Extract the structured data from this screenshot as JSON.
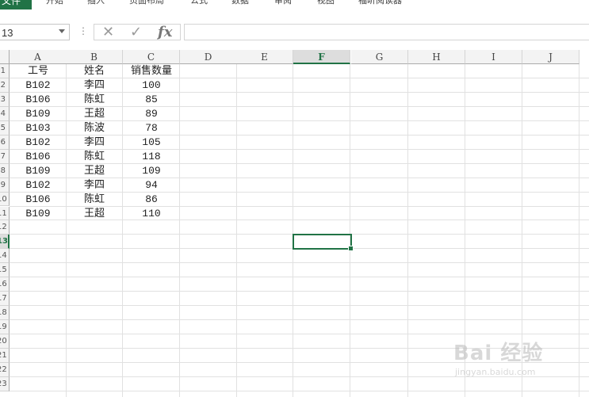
{
  "ribbon": {
    "file_tab": "文件",
    "tabs": [
      "开始",
      "插入",
      "页面布局",
      "公式",
      "数据",
      "审阅",
      "视图",
      "福昕阅读器"
    ]
  },
  "formula_bar": {
    "name_box_value": "13",
    "more_label": "⋮",
    "cancel_icon": "✕",
    "enter_icon": "✓",
    "fx_label": "fx",
    "formula_value": ""
  },
  "sheet": {
    "columns": [
      "A",
      "B",
      "C",
      "D",
      "E",
      "F",
      "G",
      "H",
      "I",
      "J"
    ],
    "selected_column": "F",
    "row_numbers": [
      "1",
      "2",
      "3",
      "4",
      "5",
      "6",
      "7",
      "8",
      "9",
      "10",
      "11",
      "12",
      "13",
      "14",
      "15",
      "16",
      "17",
      "18",
      "19",
      "20",
      "21",
      "22",
      "23"
    ],
    "selected_row": "13",
    "headers": [
      "工号",
      "姓名",
      "销售数量"
    ],
    "rows": [
      [
        "B102",
        "李四",
        "100"
      ],
      [
        "B106",
        "陈虹",
        "85"
      ],
      [
        "B109",
        "王超",
        "89"
      ],
      [
        "B103",
        "陈波",
        "78"
      ],
      [
        "B102",
        "李四",
        "105"
      ],
      [
        "B106",
        "陈虹",
        "118"
      ],
      [
        "B109",
        "王超",
        "109"
      ],
      [
        "B102",
        "李四",
        "94"
      ],
      [
        "B106",
        "陈虹",
        "86"
      ],
      [
        "B109",
        "王超",
        "110"
      ]
    ],
    "active_cell": "F13"
  },
  "watermark": {
    "brand": "Bai 经验",
    "url": "jingyan.baidu.com"
  },
  "colors": {
    "accent": "#217346",
    "grid": "#e1e1e1",
    "header_bg": "#f3f3f3"
  }
}
